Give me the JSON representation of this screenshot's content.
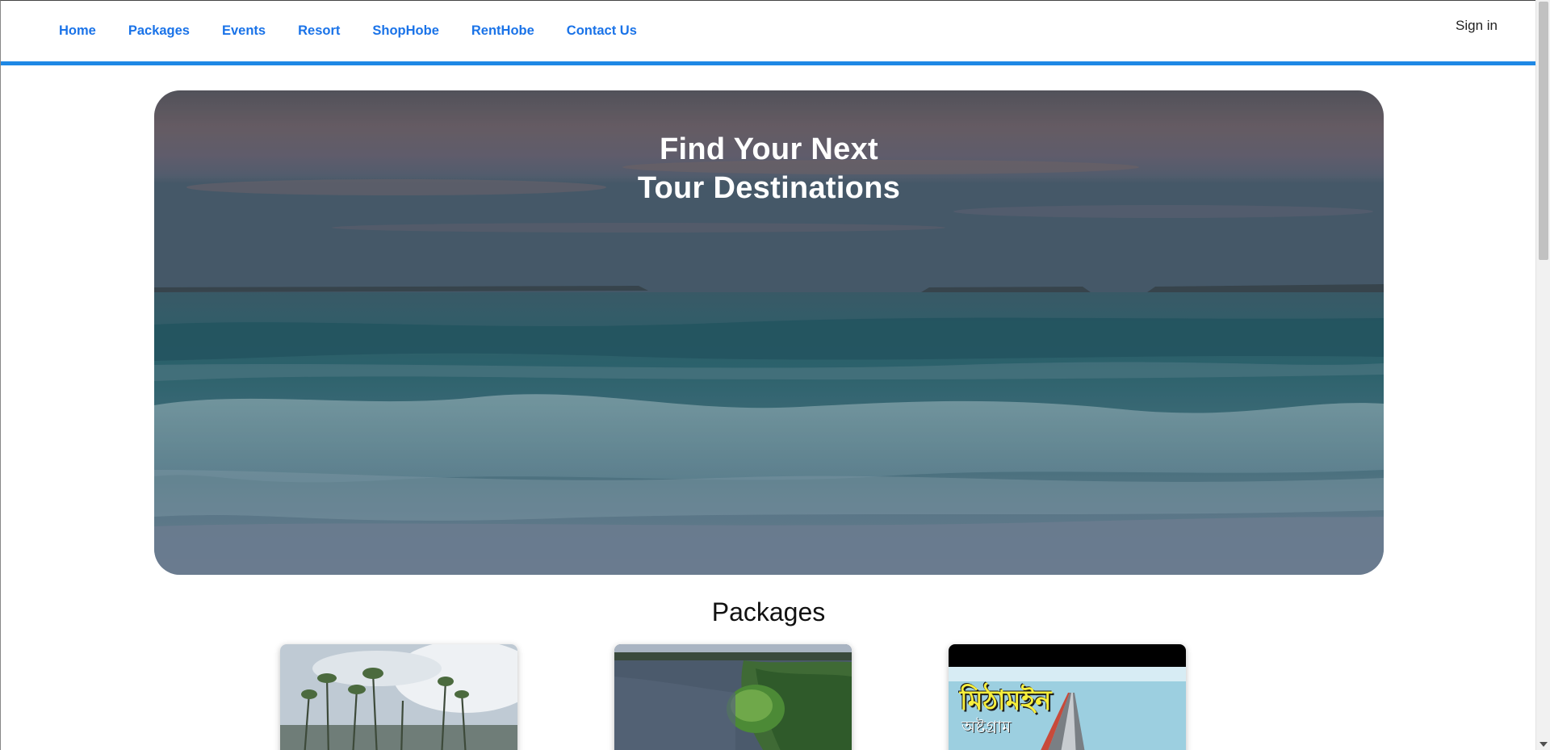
{
  "nav": {
    "links": [
      "Home",
      "Packages",
      "Events",
      "Resort",
      "ShopHobe",
      "RentHobe",
      "Contact Us"
    ],
    "signin": "Sign in"
  },
  "hero": {
    "title_line1": "Find Your Next",
    "title_line2": "Tour Destinations"
  },
  "packages": {
    "title": "Packages",
    "cards": [
      {
        "image": "mangrove-beach-photo"
      },
      {
        "image": "river-island-aerial-photo"
      },
      {
        "image": "mithamoin-road-photo",
        "overlay_title": "মিঠামইন",
        "overlay_sub": "অষ্টগ্রাম"
      }
    ]
  },
  "colors": {
    "accent": "#1e88e5",
    "nav_link": "#1a73e8"
  }
}
